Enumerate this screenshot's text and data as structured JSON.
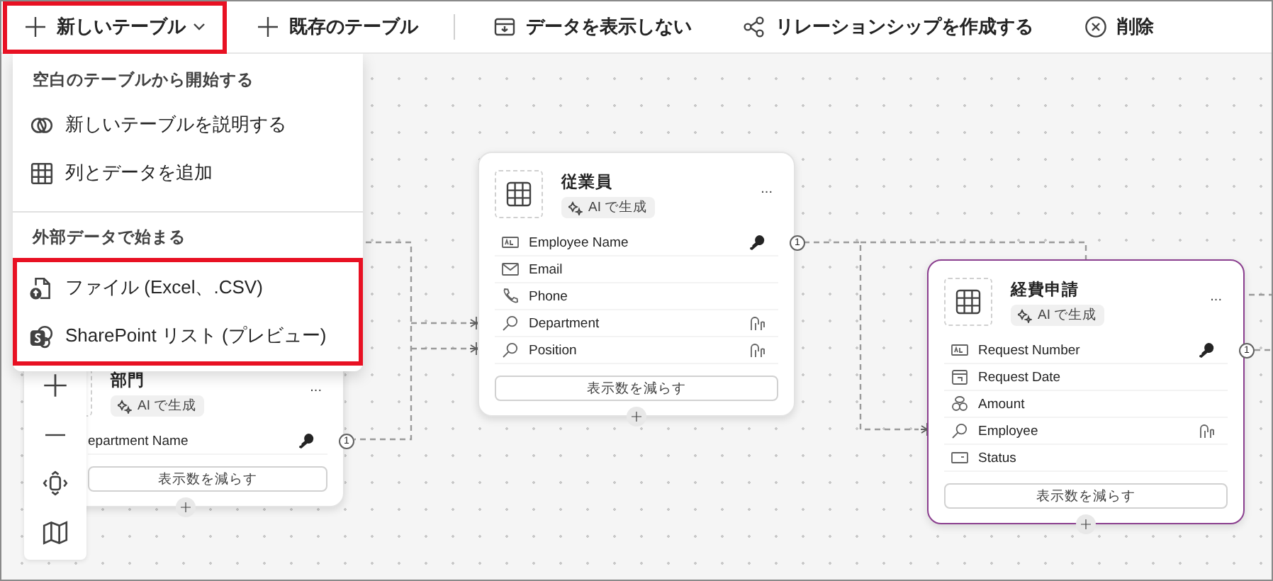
{
  "toolbar": {
    "items": [
      {
        "kind": "add",
        "label": "新しいテーブル",
        "has_menu": true,
        "highlighted": true
      },
      {
        "kind": "add",
        "label": "既存のテーブル",
        "has_menu": false,
        "highlighted": false
      },
      {
        "kind": "hide",
        "label": "データを表示しない",
        "has_menu": false,
        "highlighted": false
      },
      {
        "kind": "relationship",
        "label": "リレーションシップを作成する",
        "has_menu": false,
        "highlighted": false
      },
      {
        "kind": "delete",
        "label": "削除",
        "has_menu": false,
        "highlighted": false
      }
    ]
  },
  "menu": {
    "sections": [
      {
        "header": "空白のテーブルから開始する",
        "highlighted": false,
        "items": [
          {
            "kind": "copilot",
            "label": "新しいテーブルを説明する"
          },
          {
            "kind": "grid",
            "label": "列とデータを追加"
          }
        ]
      },
      {
        "header": "外部データで始まる",
        "highlighted": true,
        "items": [
          {
            "kind": "file",
            "label": "ファイル (Excel、.CSV)"
          },
          {
            "kind": "sharepoint",
            "label": "SharePoint リスト (プレビュー)"
          }
        ]
      }
    ]
  },
  "tables": [
    {
      "title": "部門",
      "badge": "AI で生成",
      "more": "...",
      "selected": false,
      "button": "表示数を減らす",
      "columns": [
        {
          "name": "epartment Name",
          "primary": true,
          "cardinality": "1"
        }
      ]
    },
    {
      "title": "従業員",
      "badge": "AI で生成",
      "more": "...",
      "selected": false,
      "button": "表示数を減らす",
      "columns": [
        {
          "name": "Employee Name",
          "kind": "text",
          "primary": true,
          "cardinality": "1"
        },
        {
          "name": "Email",
          "kind": "email",
          "primary": false
        },
        {
          "name": "Phone",
          "kind": "phone",
          "primary": false
        },
        {
          "name": "Department",
          "kind": "lookup",
          "primary": false
        },
        {
          "name": "Position",
          "kind": "lookup",
          "primary": false
        }
      ]
    },
    {
      "title": "経費申請",
      "badge": "AI で生成",
      "more": "...",
      "selected": true,
      "button": "表示数を減らす",
      "columns": [
        {
          "name": "Request Number",
          "kind": "text",
          "primary": true,
          "cardinality": "1"
        },
        {
          "name": "Request Date",
          "kind": "date",
          "primary": false
        },
        {
          "name": "Amount",
          "kind": "currency",
          "primary": false
        },
        {
          "name": "Employee",
          "kind": "lookup",
          "primary": false
        },
        {
          "name": "Status",
          "kind": "choice",
          "primary": false
        }
      ]
    }
  ]
}
